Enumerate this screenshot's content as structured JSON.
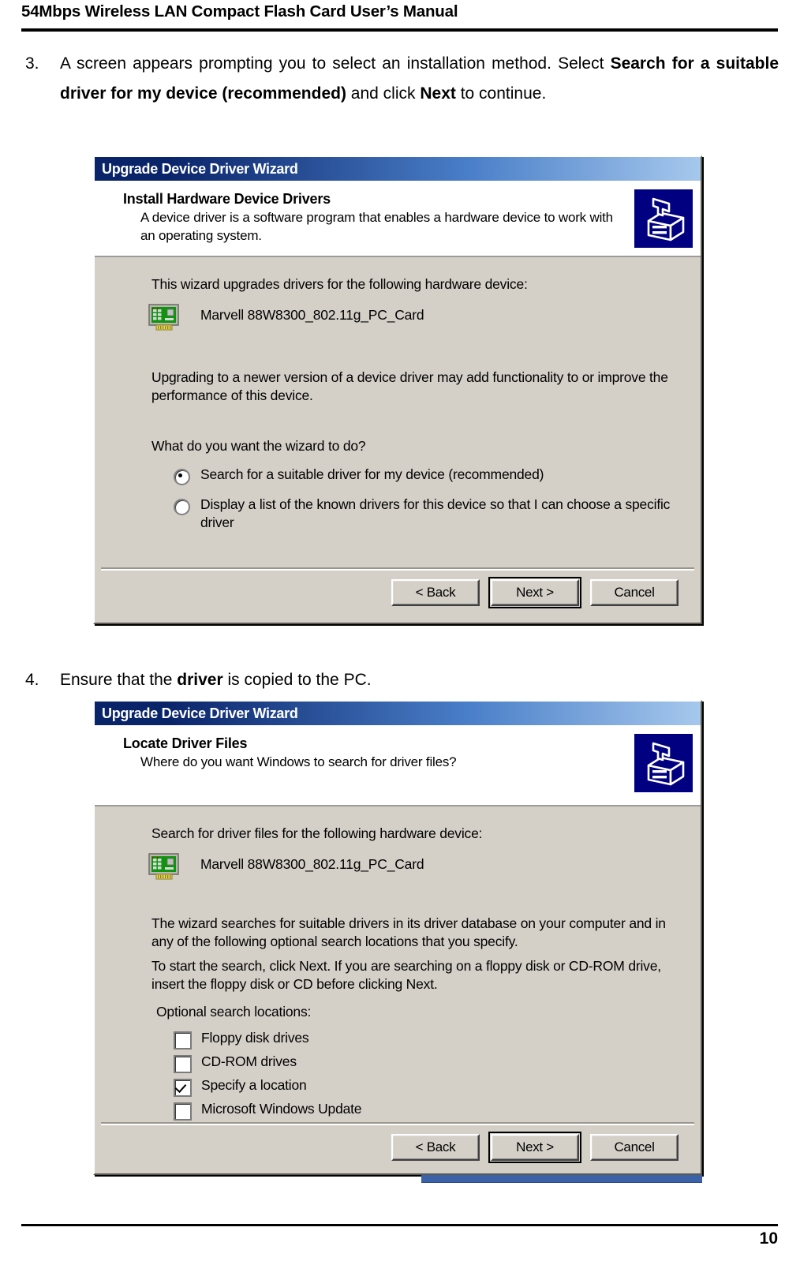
{
  "document": {
    "header_title": "54Mbps Wireless LAN Compact Flash Card User’s Manual",
    "page_number": "10"
  },
  "steps": [
    {
      "number": "3.",
      "text_part1": "A screen appears prompting you to select an installation method. Select ",
      "bold1": "Search for a suitable driver for my device (recommended)",
      "text_part2": " and click ",
      "bold2": "Next",
      "text_part3": " to continue."
    },
    {
      "number": "4.",
      "text_part1": "Ensure that the ",
      "bold1": "driver",
      "text_part2": " is copied to the PC."
    }
  ],
  "dialog1": {
    "title": "Upgrade Device Driver Wizard",
    "banner_heading": "Install Hardware Device Drivers",
    "banner_sub_line1": "A device driver is a software program that enables a hardware device to work with",
    "banner_sub_line2": "an operating system.",
    "intro": "This wizard upgrades drivers for the following hardware device:",
    "device_name": "Marvell 88W8300_802.11g_PC_Card",
    "note_line1": "Upgrading to a newer version of a device driver may add functionality to or improve the",
    "note_line2": "performance of this device.",
    "question": "What do you want the wizard to do?",
    "options": [
      {
        "label": "Search for a suitable driver for my device (recommended)",
        "checked": true
      },
      {
        "label": "Display a list of the known drivers for this device so that I can choose a specific",
        "label_line2": "driver",
        "checked": false
      }
    ],
    "buttons": {
      "back": "< Back",
      "next": "Next >",
      "cancel": "Cancel"
    }
  },
  "dialog2": {
    "title": "Upgrade Device Driver Wizard",
    "banner_heading": "Locate Driver Files",
    "banner_sub_line1": "Where do you want Windows to search for driver files?",
    "intro": "Search for driver files for the following hardware device:",
    "device_name": "Marvell 88W8300_802.11g_PC_Card",
    "note_line1": "The wizard searches for suitable drivers in its driver database on your computer and in",
    "note_line2": "any of the following optional search locations that you specify.",
    "note_line3": "To start the search, click Next. If you are searching on a floppy disk or CD-ROM drive,",
    "note_line4": "insert the floppy disk or CD before clicking Next.",
    "locations_label": "Optional search locations:",
    "locations": [
      {
        "label": "Floppy disk drives",
        "checked": false
      },
      {
        "label": "CD-ROM drives",
        "checked": false
      },
      {
        "label": "Specify a location",
        "checked": true
      },
      {
        "label": "Microsoft Windows Update",
        "checked": false
      }
    ],
    "buttons": {
      "back": "< Back",
      "next": "Next >",
      "cancel": "Cancel"
    }
  },
  "colors": {
    "titlebar_start": "#0a246a",
    "titlebar_end": "#a6c8ec",
    "dialog_face": "#d4d0c8",
    "wizard_icon_bg": "#000080",
    "device_icon_green": "#00a000"
  }
}
